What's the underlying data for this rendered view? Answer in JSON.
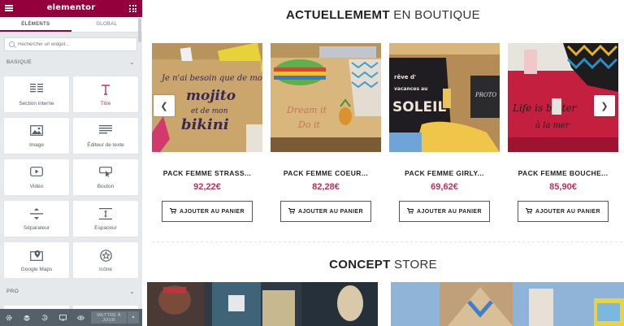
{
  "editor": {
    "logo": "elementor",
    "tabs": [
      {
        "label": "ÉLÉMENTS",
        "active": true
      },
      {
        "label": "GLOBAL",
        "active": false
      }
    ],
    "search": {
      "placeholder": "Rechercher un widget..."
    },
    "sections": [
      {
        "label": "BASIQUE"
      },
      {
        "label": "PRO"
      }
    ],
    "widgets": [
      {
        "label": "Section interne",
        "icon": "columns-icon"
      },
      {
        "label": "Titre",
        "icon": "heading-t-icon"
      },
      {
        "label": "Image",
        "icon": "image-icon"
      },
      {
        "label": "Éditeur de texte",
        "icon": "text-lines-icon"
      },
      {
        "label": "Vidéo",
        "icon": "video-play-icon"
      },
      {
        "label": "Bouton",
        "icon": "button-cursor-icon"
      },
      {
        "label": "Séparateur",
        "icon": "divider-icon"
      },
      {
        "label": "Espaceur",
        "icon": "spacer-icon"
      },
      {
        "label": "Google Maps",
        "icon": "map-pin-icon"
      },
      {
        "label": "Icône",
        "icon": "star-circle-icon"
      }
    ],
    "footer": {
      "publish_label": "METTRE À JOUR",
      "icons": [
        "settings-icon",
        "layers-icon",
        "history-icon",
        "responsive-icon",
        "preview-eye-icon"
      ]
    },
    "accent_color": "#93003c"
  },
  "preview": {
    "heading1": {
      "bold": "ACTUELLEMEMT",
      "rest": "EN BOUTIQUE"
    },
    "products": [
      {
        "name": "PACK FEMME STRASS...",
        "price": "92,22€",
        "button": "AJOUTER AU PANIER",
        "image_text": "Je n'ai besoin que de mojito et de mon bikini"
      },
      {
        "name": "PACK FEMME COEUR...",
        "price": "82,28€",
        "button": "AJOUTER AU PANIER",
        "image_text": "Dream it Do it"
      },
      {
        "name": "PACK FEMME GIRLY...",
        "price": "69,62€",
        "button": "AJOUTER AU PANIER",
        "image_text": "SOLEIL"
      },
      {
        "name": "PACK FEMME BOUCHE...",
        "price": "85,90€",
        "button": "AJOUTER AU PANIER",
        "image_text": "Life is better à la mer"
      }
    ],
    "heading2": {
      "bold": "CONCEPT",
      "rest": "STORE"
    },
    "price_color": "#c0305a"
  }
}
